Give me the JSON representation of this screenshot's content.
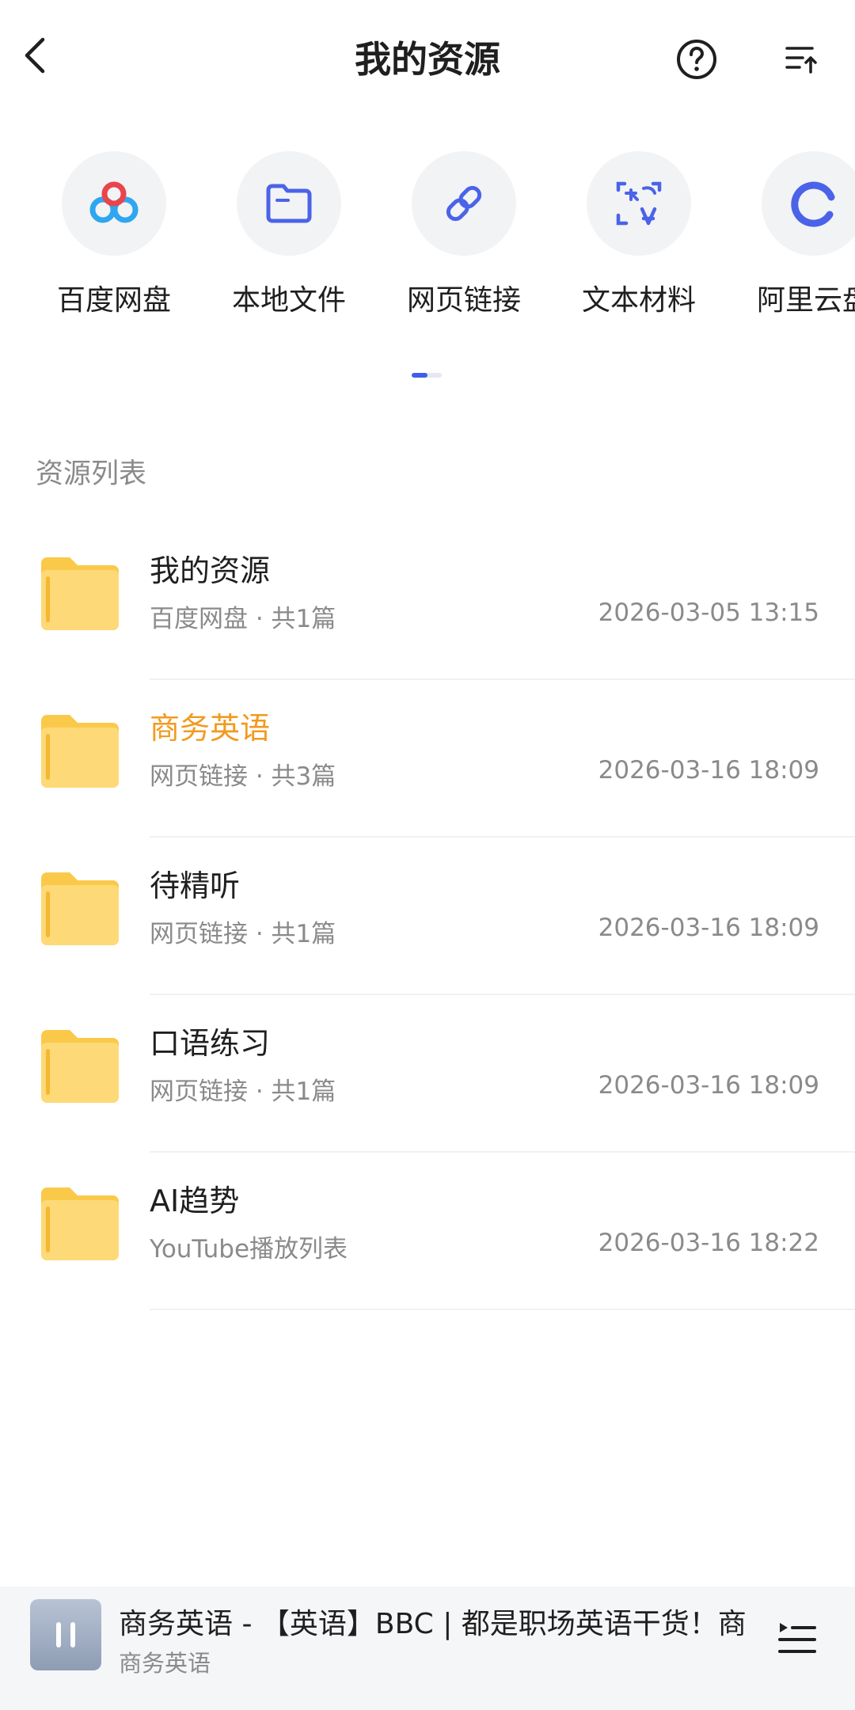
{
  "header": {
    "title": "我的资源"
  },
  "sources": [
    {
      "label": "百度网盘",
      "icon": "baidu-netdisk-icon"
    },
    {
      "label": "本地文件",
      "icon": "folder-icon"
    },
    {
      "label": "网页链接",
      "icon": "link-icon"
    },
    {
      "label": "文本材料",
      "icon": "text-scan-icon"
    },
    {
      "label": "阿里云盘",
      "icon": "aliyun-drive-icon"
    }
  ],
  "section_label": "资源列表",
  "resources": [
    {
      "title": "我的资源",
      "subtitle": "百度网盘 · 共1篇",
      "date": "2026-03-05 13:15",
      "active": false
    },
    {
      "title": "商务英语",
      "subtitle": "网页链接 · 共3篇",
      "date": "2026-03-16 18:09",
      "active": true
    },
    {
      "title": "待精听",
      "subtitle": "网页链接 · 共1篇",
      "date": "2026-03-16 18:09",
      "active": false
    },
    {
      "title": "口语练习",
      "subtitle": "网页链接 · 共1篇",
      "date": "2026-03-16 18:09",
      "active": false
    },
    {
      "title": "AI趋势",
      "subtitle": "YouTube播放列表",
      "date": "2026-03-16 18:22",
      "active": false
    }
  ],
  "player": {
    "title": "商务英语 - 【英语】BBC | 都是职场英语干货！商",
    "subtitle": "商务英语",
    "state": "paused-icon"
  },
  "colors": {
    "accent": "#3f5ee8",
    "active_title": "#f29a1e",
    "folder": "#fcd468"
  }
}
